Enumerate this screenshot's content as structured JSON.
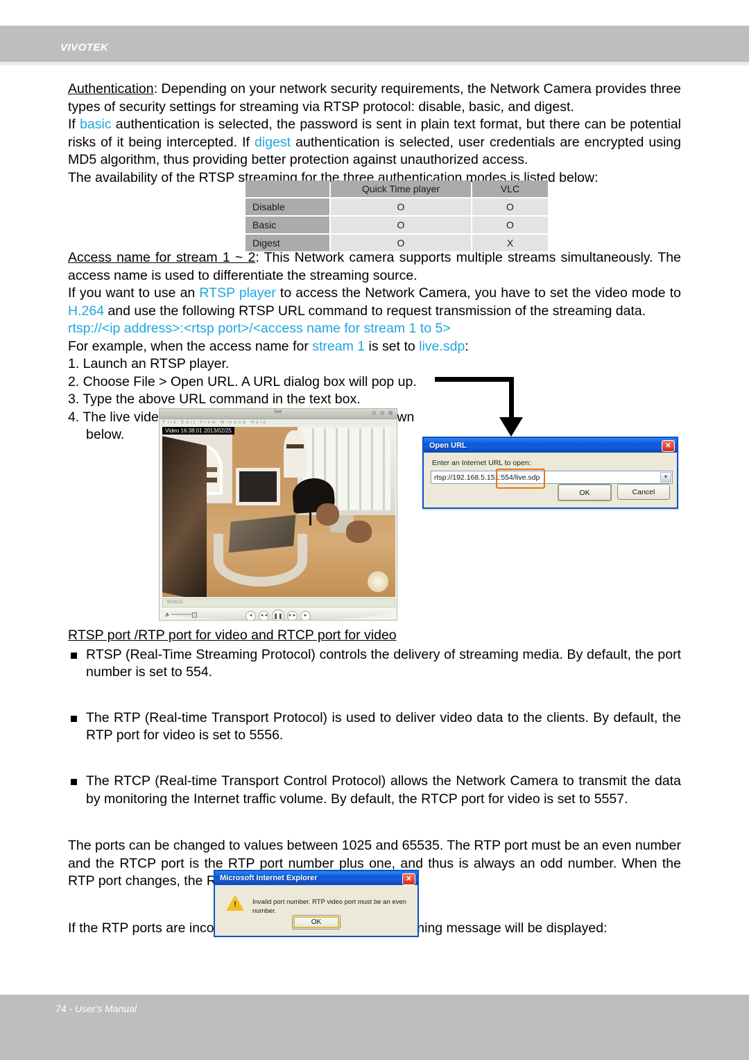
{
  "header": {
    "brand": "VIVOTEK"
  },
  "footer": {
    "text": "74 - User's Manual"
  },
  "colors": {
    "header_bg": "#bcbfbe",
    "footer_bg": "#bcbfbe",
    "link_blue": "#1ca7e0",
    "highlight_orange": "#e87410",
    "table_header_bg": "#a9acab",
    "table_cell_bg": "#e2e4e3",
    "dialog_titlebar_blue": "#0a52d8"
  },
  "sections": {
    "authentication": {
      "term": "Authentication",
      "line1_rest": ": Depending on your network security requirements, the Network Camera provides three types of security settings for streaming via RTSP protocol: disable, basic, and digest.",
      "line2_a": "If ",
      "line2_kw1": "basic",
      "line2_b": " authentication is selected, the password is sent in plain text format, but there can be potential risks of it being intercepted. If ",
      "line2_kw2": "digest",
      "line2_c": " authentication is selected, user credentials are encrypted using MD5 algorithm, thus providing better protection against unauthorized access.",
      "line3": "The availability of the RTSP streaming for the three authentication modes is listed below:"
    },
    "access_name": {
      "term": "Access name for stream 1 ~ 2",
      "line1_rest": ": This Network camera supports multiple streams simultaneously. The access name is used to differentiate the streaming source.",
      "line2_a": "If you want to use an ",
      "line2_kw1": "RTSP player",
      "line2_b": " to access the Network Camera, you have to set the video mode to ",
      "line2_kw2": "H.264",
      "line2_c": " and use the following RTSP URL command to request transmission of the streaming data.",
      "url_template": "rtsp://<ip address>:<rtsp port>/<access name for stream 1 to 5>",
      "example_a": "For example, when the access name for ",
      "example_kw1": "stream 1",
      "example_b": " is set to ",
      "example_kw2": "live.sdp",
      "example_c": ":"
    },
    "steps": [
      "1. Launch an RTSP player.",
      "2. Choose File > Open URL. A URL dialog box will pop up.",
      "3. Type the above URL command in the text box.",
      "4. The live video will be displayed in your player as shown",
      "below."
    ],
    "ports": {
      "heading": "RTSP port /RTP port for video and RTCP port for video",
      "bullets": [
        "RTSP (Real-Time Streaming Protocol) controls the delivery of streaming media. By default, the port number is set to 554.",
        "The RTP (Real-time Transport Protocol) is used to deliver video data to the clients. By default, the RTP port for video is set to 5556.",
        "The RTCP (Real-time Transport Control Protocol) allows the Network Camera to transmit the data by monitoring the Internet traffic volume. By default, the RTCP port for video is set to 5557."
      ],
      "paragraph": "The ports can be changed to values between 1025 and 65535. The RTP port must be an even number and the RTCP port is the RTP port number plus one, and thus is always an odd number. When the RTP port changes, the RTCP port will change accordingly.",
      "warning_intro": "If the RTP ports are incorrectly assigned, the following warning message will be displayed:"
    }
  },
  "availability_table": {
    "columns": [
      "",
      "Quick Time player",
      "VLC"
    ],
    "rows": [
      {
        "label": "Disable",
        "quicktime": "O",
        "vlc": "O"
      },
      {
        "label": "Basic",
        "quicktime": "O",
        "vlc": "O"
      },
      {
        "label": "Digest",
        "quicktime": "O",
        "vlc": "X"
      }
    ]
  },
  "player_window": {
    "title": "live",
    "menu": "File  Edit  View  Window  Help",
    "window_buttons": "⊡ ⊟ ⊠",
    "osd_timestamp": "Video 16:38:01 2013/02/25",
    "timecode": "00:00:21",
    "controls": [
      "skip-start",
      "rewind",
      "pause",
      "fast-forward",
      "skip-end"
    ]
  },
  "open_url_dialog": {
    "title": "Open URL",
    "label": "Enter an Internet URL to open:",
    "url_value": "rtsp://192.168.5.151",
    "url_highlight": ":554/live.sdp",
    "ok_label": "OK",
    "cancel_label": "Cancel"
  },
  "ie_warning_dialog": {
    "title": "Microsoft Internet Explorer",
    "message": "Invalid port number. RTP video port must be an even number.",
    "ok_label": "OK",
    "icon": "warning-triangle-icon"
  }
}
